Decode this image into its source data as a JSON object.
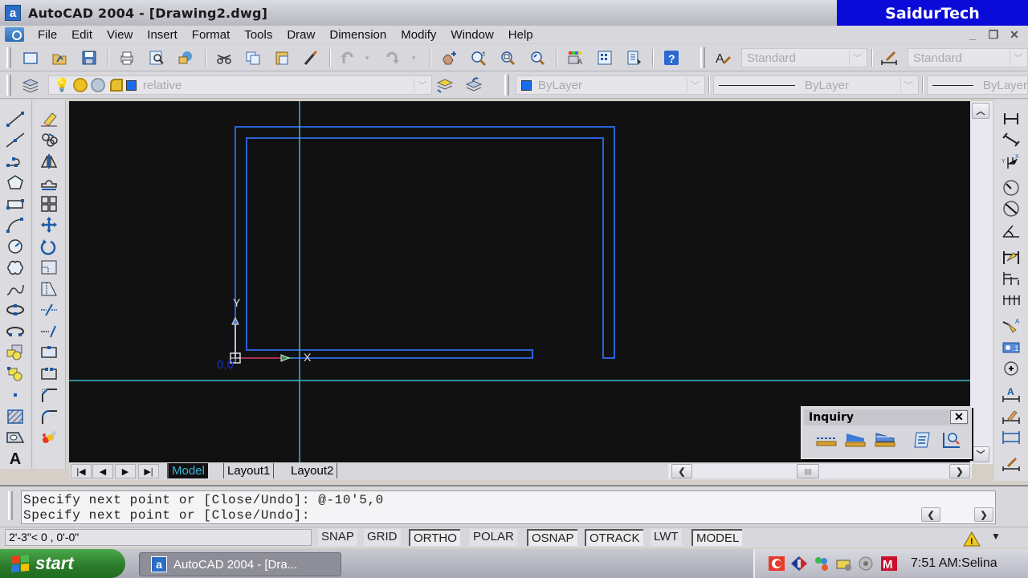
{
  "window": {
    "title": "AutoCAD 2004 - [Drawing2.dwg]",
    "app_icon_letter": "a",
    "brand_overlay": "SaidurTech",
    "controls": {
      "minimize": "_",
      "restore": "❐",
      "close": "✕"
    }
  },
  "menu": {
    "items": [
      "File",
      "Edit",
      "View",
      "Insert",
      "Format",
      "Tools",
      "Draw",
      "Dimension",
      "Modify",
      "Window",
      "Help"
    ]
  },
  "standard_toolbar": {
    "buttons": [
      "new",
      "open",
      "save",
      "plot",
      "plot-preview",
      "publish",
      "cut",
      "copy",
      "paste",
      "match-properties",
      "undo",
      "redo",
      "pan-realtime",
      "zoom-realtime",
      "zoom-window",
      "zoom-previous",
      "tool-palettes",
      "design-center",
      "properties",
      "help"
    ]
  },
  "styles_toolbar": {
    "text_style": "Standard",
    "dim_style": "Standard"
  },
  "layers_toolbar": {
    "current_layer": "relative",
    "layer_color": "#1a6cf0"
  },
  "properties_toolbar": {
    "color": "ByLayer",
    "linetype": "ByLayer",
    "lineweight": "ByLayer"
  },
  "draw_toolbar": {
    "tools": [
      "line",
      "construction-line",
      "polyline",
      "polygon",
      "rectangle",
      "arc",
      "circle",
      "revision-cloud",
      "spline",
      "ellipse",
      "ellipse-arc",
      "insert-block",
      "make-block",
      "point",
      "hatch",
      "region",
      "multiline-text"
    ]
  },
  "modify_toolbar": {
    "tools": [
      "erase",
      "copy",
      "mirror",
      "offset",
      "array",
      "move",
      "rotate",
      "scale",
      "stretch",
      "trim",
      "extend",
      "break-at-point",
      "break",
      "chamfer",
      "fillet",
      "explode"
    ]
  },
  "dimension_toolbar": {
    "tools": [
      "linear",
      "aligned",
      "ordinate",
      "radius",
      "diameter",
      "angular",
      "quick-dimension",
      "baseline",
      "continue",
      "quick-leader",
      "tolerance",
      "center-mark",
      "dimension-edit",
      "dimension-text-edit",
      "dimension-update",
      "dimension-style"
    ]
  },
  "drawing": {
    "background": "#111111",
    "wall_color": "#2a62d6",
    "crosshair_color": "#3ab8c8",
    "ucs": {
      "x_label": "X",
      "y_label": "Y",
      "origin_label": "0,0"
    }
  },
  "tabs": {
    "items": [
      "Model",
      "Layout1",
      "Layout2"
    ],
    "active": "Model"
  },
  "inquiry_toolbar": {
    "title": "Inquiry",
    "close": "✕",
    "tools": [
      "distance",
      "area",
      "mass-properties",
      "list",
      "locate-point"
    ]
  },
  "command_line": {
    "history": "Specify next point or [Close/Undo]: @-10'5,0",
    "prompt": "Specify next point or [Close/Undo]:"
  },
  "status_bar": {
    "coordinates": "2'-3\"<    0 , 0'-0\"",
    "toggles": [
      {
        "label": "SNAP",
        "on": false
      },
      {
        "label": "GRID",
        "on": false
      },
      {
        "label": "ORTHO",
        "on": true
      },
      {
        "label": "POLAR",
        "on": false
      },
      {
        "label": "OSNAP",
        "on": true
      },
      {
        "label": "OTRACK",
        "on": true
      },
      {
        "label": "LWT",
        "on": false
      },
      {
        "label": "MODEL",
        "on": true
      }
    ]
  },
  "taskbar": {
    "start_label": "start",
    "task_item": "AutoCAD 2004 - [Dra...",
    "clock": "7:51 AM:Selina",
    "tray_icons": [
      "antivirus-icon",
      "network-diamond-icon",
      "msn-messenger-icon",
      "hardware-icon",
      "speaker-icon",
      "mcafee-icon"
    ]
  }
}
